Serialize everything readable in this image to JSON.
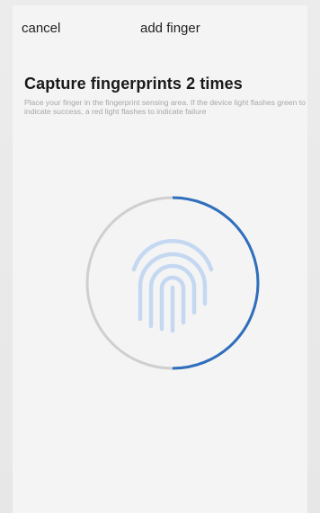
{
  "header": {
    "cancel_label": "cancel",
    "title": "add finger"
  },
  "capture": {
    "title": "Capture fingerprints 2 times",
    "instructions": "Place your finger in the fingerprint sensing area. If the device light flashes green to indicate success, a red light flashes to indicate failure",
    "progress_fraction": 0.5
  },
  "icons": {
    "sensor": "fingerprint-icon"
  },
  "colors": {
    "progress_arc": "#2f6fbd",
    "progress_track": "#cfcfcf",
    "fingerprint": "#c5d8f2",
    "title_text": "#1a1a1a",
    "description_text": "#a6a6a6"
  }
}
